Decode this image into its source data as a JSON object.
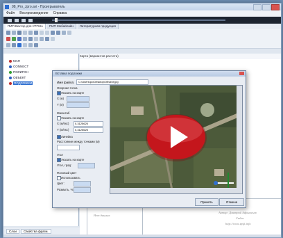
{
  "window": {
    "title": "98_Pro_Jpro.avi - Проигрыватель"
  },
  "menu": [
    "Файл",
    "Воспроизведение",
    "Справка"
  ],
  "tabs": [
    "ПИП Вектор для УРПНА",
    "ПИП Мобайлайн",
    "Литературная продукция"
  ],
  "doc_tabs": [
    "ПИП Вектор для УРПНА",
    "Мобайлайн",
    "Набор(ный стиль)"
  ],
  "tree": {
    "items": [
      "МАП",
      "CONNECT",
      "ПОЛИГОН",
      "ОБЪЕКТ",
      "ПОДЛОЖКИ"
    ],
    "selected_index": 4
  },
  "bottom_tabs": [
    "Слои",
    "Свойства фрагм."
  ],
  "right_header": "Карта (вариантов расчета)",
  "dialog": {
    "title": "Вставка подложки",
    "file_label": "Имя файла:",
    "file_value": "C:\\Users\\pc\\Desktop\\Объект.jpg",
    "section_origin": "Опорная точка",
    "show_on_map": "Указать на карте",
    "x_label": "X (м)",
    "y_label": "Y (м)",
    "section_scale": "Масштаб",
    "scale_on_map": "Указать на карте",
    "x_size_label": "X (м/пкс)",
    "x_size_value": "0,3125625",
    "y_size_label": "Y (м/пкс)",
    "y_size_value": "0,3125625",
    "ruler_label": "Линейка",
    "distance_label": "Расстояние между точками (м)",
    "section_angle": "Угол",
    "angle_on_map": "Указать на карте",
    "angle_label": "Угол, град:",
    "transparent_label": "Фоновый цвет",
    "use_label": "Использовать",
    "color_label": "Цвет:",
    "blur_label": "Размыть, %:",
    "ok": "Принять",
    "cancel": "Отмена"
  },
  "watermark": {
    "line1": "Автор: Дмитрий Афонасьев",
    "line2": "Сайт:",
    "line3": "http://www.tpsft.info",
    "left_note": "Нет данных"
  },
  "colors": {
    "play_red": "#c4161c",
    "accent": "#2f6fd0"
  }
}
